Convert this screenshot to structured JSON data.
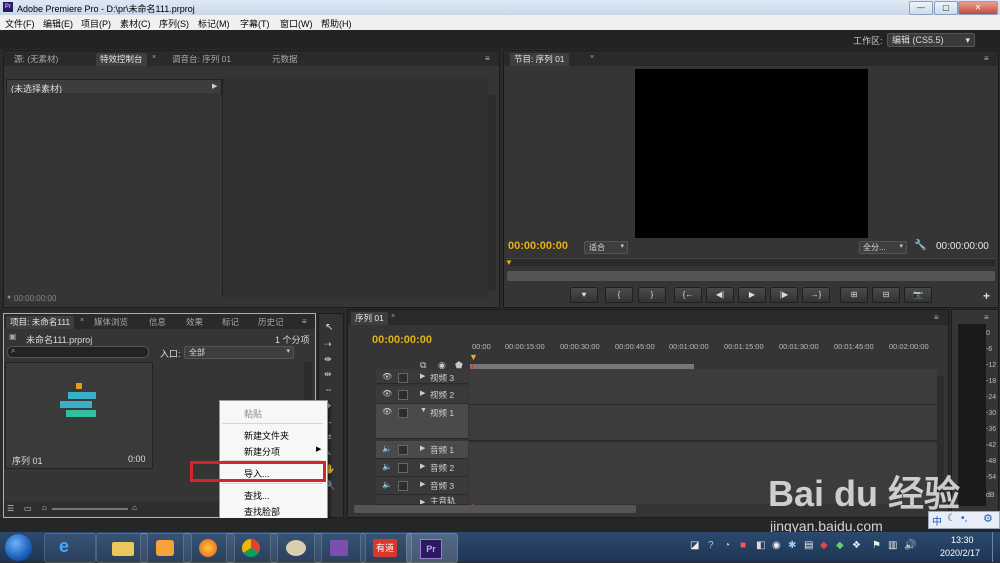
{
  "window": {
    "title": "Adobe Premiere Pro - D:\\pr\\未命名111.prproj",
    "min": "—",
    "max": "▢",
    "close": "✕"
  },
  "menu": [
    "文件(F)",
    "编辑(E)",
    "项目(P)",
    "素材(C)",
    "序列(S)",
    "标记(M)",
    "字幕(T)",
    "窗口(W)",
    "帮助(H)"
  ],
  "workspace": {
    "label": "工作区:",
    "value": "编辑 (CS5.5)"
  },
  "source_panel": {
    "tabs": [
      "源: (无素材)",
      "特效控制台",
      "调音台: 序列 01",
      "元数据"
    ],
    "no_clip": "(未选择素材)",
    "timecode": "00:00:00:00"
  },
  "program_panel": {
    "tab": "节目: 序列 01",
    "timecode_left": "00:00:00:00",
    "fit": "适合",
    "full": "全分...",
    "timecode_right": "00:00:00:00"
  },
  "project_panel": {
    "tabs": [
      "项目: 未命名111",
      "媒体浏览",
      "信息",
      "效果",
      "标记",
      "历史记"
    ],
    "file": "未命名111.prproj",
    "count": "1 个分项",
    "entry_label": "入口:",
    "entry_value": "全部",
    "item_name": "序列 01",
    "item_duration": "0:00"
  },
  "timeline": {
    "tab": "序列 01",
    "timecode": "00:00:00:00",
    "ruler": [
      "00:00",
      "00:00:15:00",
      "00:00:30:00",
      "00:00:45:00",
      "00:01:00:00",
      "00:01:15:00",
      "00:01:30:00",
      "00:01:45:00",
      "00:02:00:00"
    ],
    "tracks": [
      "视频 3",
      "视频 2",
      "视频 1",
      "音频 1",
      "音频 2",
      "音频 3",
      "主音轨"
    ]
  },
  "meter": {
    "labels": [
      "0",
      "-6",
      "-12",
      "-18",
      "-24",
      "-30",
      "-36",
      "-42",
      "-48",
      "-54"
    ],
    "unit": "dB"
  },
  "context_menu": {
    "items": [
      "粘贴",
      "新建文件夹",
      "新建分项",
      "导入...",
      "查找...",
      "查找脸部"
    ]
  },
  "watermark": {
    "text": "Bai du 经验",
    "url": "jingyan.baidu.com"
  },
  "ime": "中",
  "taskbar": {
    "time": "13:30",
    "date": "2020/2/17",
    "youdao": "有道"
  }
}
